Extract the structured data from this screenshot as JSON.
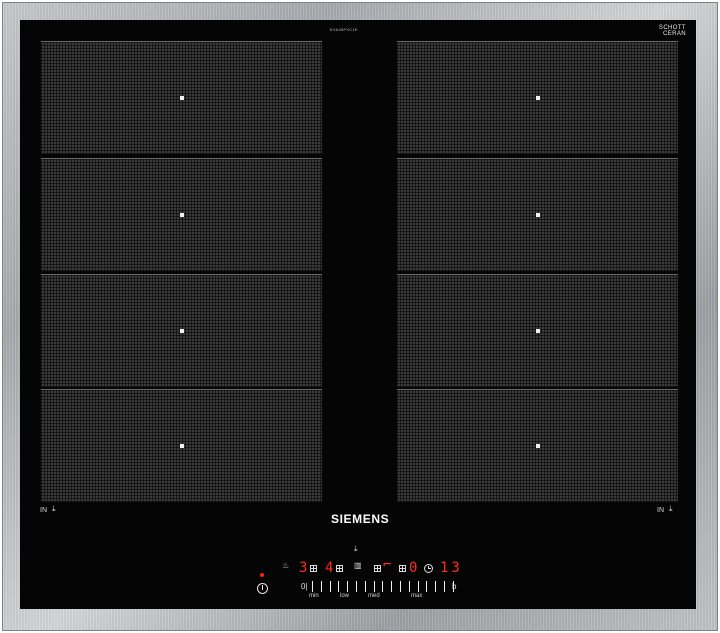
{
  "appliance": {
    "model": "EX645FXC1E",
    "glass_brand_line1": "SCHOTT",
    "glass_brand_line2": "CERAN",
    "brand": "SIEMENS",
    "colors": {
      "frame": "#b5b8bb",
      "glass": "#050505",
      "zone": "#3a3a3a",
      "display": "#ff2a1a"
    }
  },
  "zones": [
    {
      "name": "zone-left-1"
    },
    {
      "name": "zone-left-2"
    },
    {
      "name": "zone-left-3"
    },
    {
      "name": "zone-left-4"
    },
    {
      "name": "zone-right-1"
    },
    {
      "name": "zone-right-2"
    },
    {
      "name": "zone-right-3"
    },
    {
      "name": "zone-right-4"
    }
  ],
  "side_labels": {
    "left": "IN",
    "right": "IN"
  },
  "controls": {
    "display_1": "3",
    "display_2": "4",
    "display_3": "0",
    "display_4": "13",
    "slider_start": "0|",
    "slider_end": "b",
    "slider_labels": [
      "min",
      "low",
      "med",
      "max"
    ]
  }
}
